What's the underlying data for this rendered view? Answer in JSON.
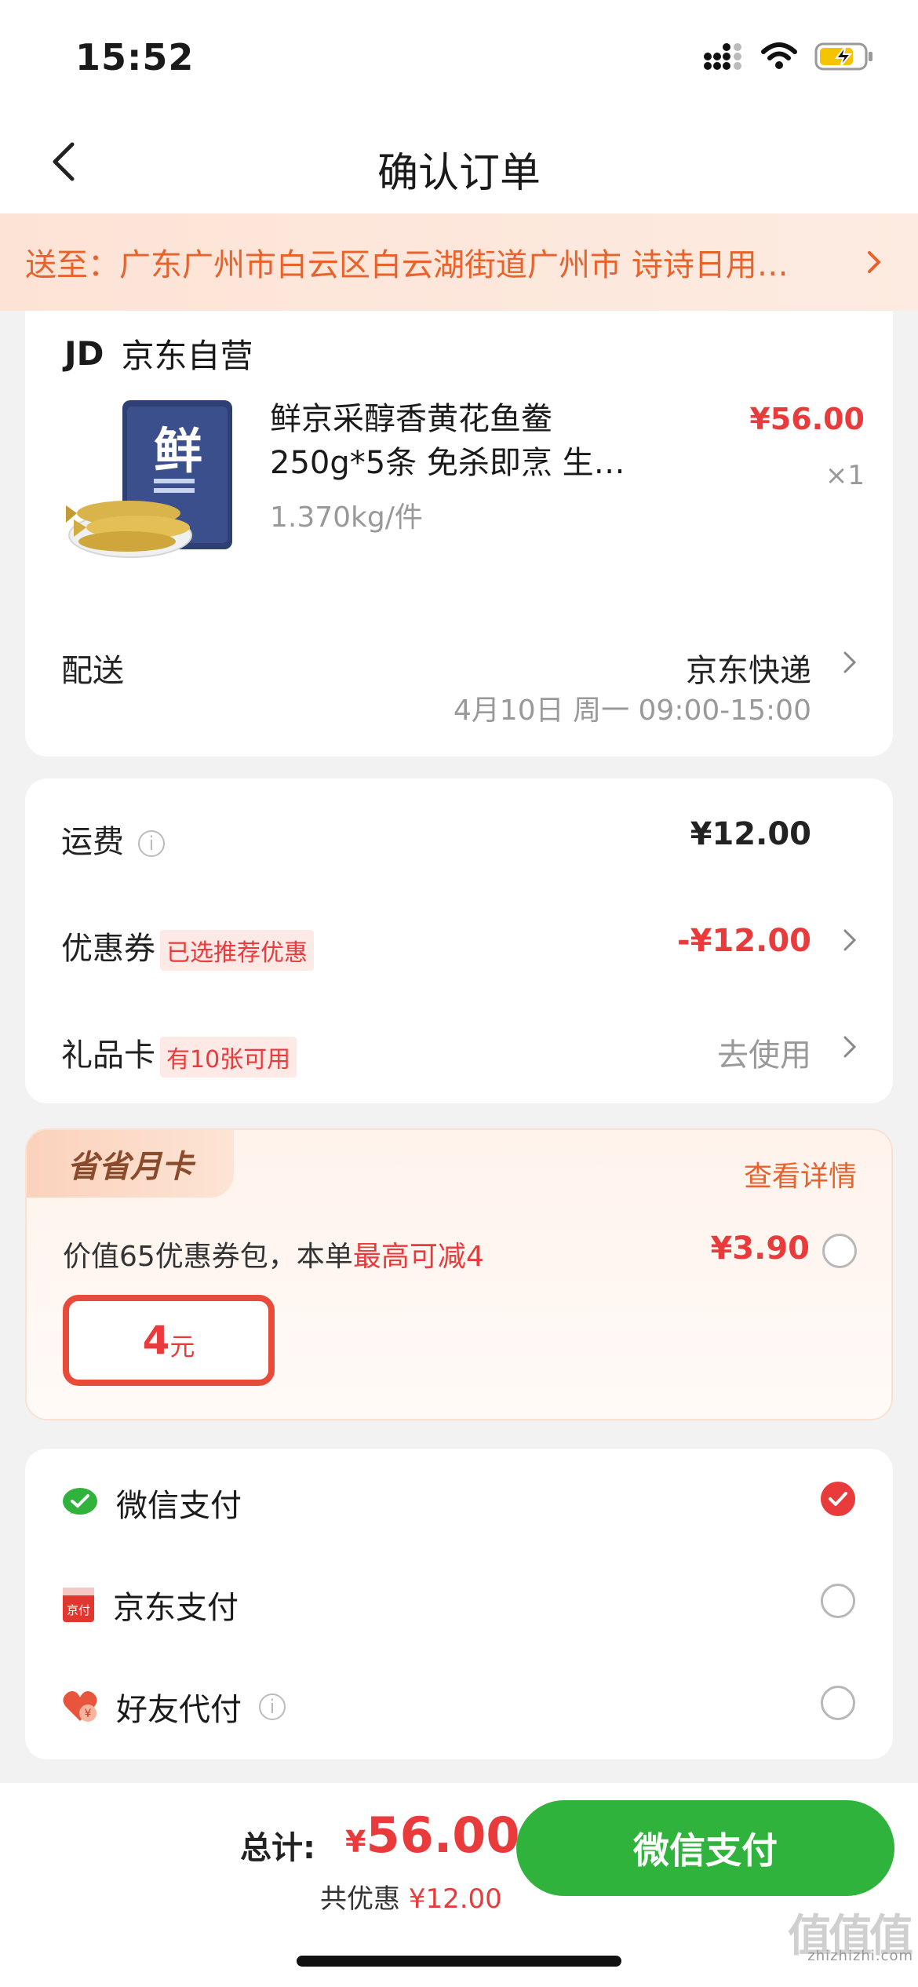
{
  "status": {
    "time": "15:52"
  },
  "nav": {
    "title": "确认订单"
  },
  "address": {
    "text": "送至：广东广州市白云区白云湖街道广州市  诗诗日用…"
  },
  "store": {
    "logo": "JD",
    "name": "京东自营"
  },
  "product": {
    "title": "鲜京采醇香黄花鱼鲞250g*5条 免杀即烹 生…",
    "spec": "1.370kg/件",
    "price": "¥56.00",
    "qty": "×1",
    "image_label": "鲜"
  },
  "delivery": {
    "label": "配送",
    "method": "京东快递",
    "time": "4月10日 周一 09:00-15:00"
  },
  "fees": {
    "shipping_label": "运费",
    "shipping_value": "¥12.00",
    "coupon_label": "优惠券",
    "coupon_tag": "已选推荐优惠",
    "coupon_value": "-¥12.00",
    "giftcard_label": "礼品卡",
    "giftcard_tag": "有10张可用",
    "giftcard_action": "去使用"
  },
  "monthly_card": {
    "badge": "省省月卡",
    "detail_link": "查看详情",
    "desc_prefix": "价值65优惠券包，本单",
    "desc_highlight": "最高可减4",
    "price": "¥3.90",
    "voucher_amount": "4",
    "voucher_unit": "元"
  },
  "payment": {
    "options": [
      {
        "label": "微信支付",
        "selected": true
      },
      {
        "label": "京东支付",
        "selected": false
      },
      {
        "label": "好友代付",
        "selected": false
      }
    ],
    "jd_icon_text": "京付",
    "friend_icon_text": "¥"
  },
  "footer": {
    "total_label": "总计:",
    "currency": "¥",
    "total_value": "56.00",
    "saved_prefix": "共优惠",
    "saved_value": "¥12.00",
    "pay_button": "微信支付"
  },
  "watermark": {
    "site": "zhizhizhi.com",
    "logo": "值值值"
  },
  "colors": {
    "accent": "#e93b3b",
    "wechat_green": "#2fb33c",
    "address_orange": "#e8622c"
  }
}
